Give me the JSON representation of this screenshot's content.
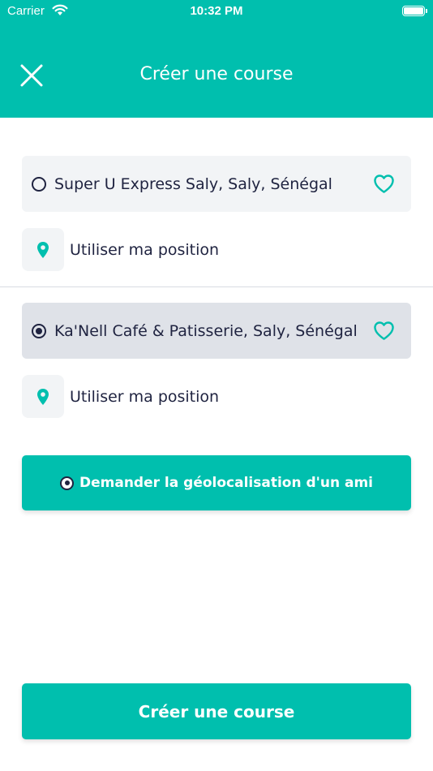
{
  "status_bar": {
    "carrier": "Carrier",
    "time": "10:32 PM"
  },
  "header": {
    "title": "Créer une course",
    "close_icon": "close-icon"
  },
  "origin": {
    "address": "Super U Express Saly, Saly, Sénégal",
    "selected": false,
    "favorite_icon": "heart-outline-icon",
    "use_position_label": "Utiliser ma position"
  },
  "destination": {
    "address": "Ka'Nell Café & Patisserie, Saly, Sénégal",
    "selected": true,
    "favorite_icon": "heart-outline-icon",
    "use_position_label": "Utiliser ma position"
  },
  "friend_button": {
    "label": "Demander la géolocalisation d'un ami"
  },
  "create_button": {
    "label": "Créer une course"
  },
  "colors": {
    "primary": "#00bfae",
    "text": "#1f2340",
    "origin_bg": "#f2f4f6",
    "destination_bg": "#dfe2e8"
  }
}
